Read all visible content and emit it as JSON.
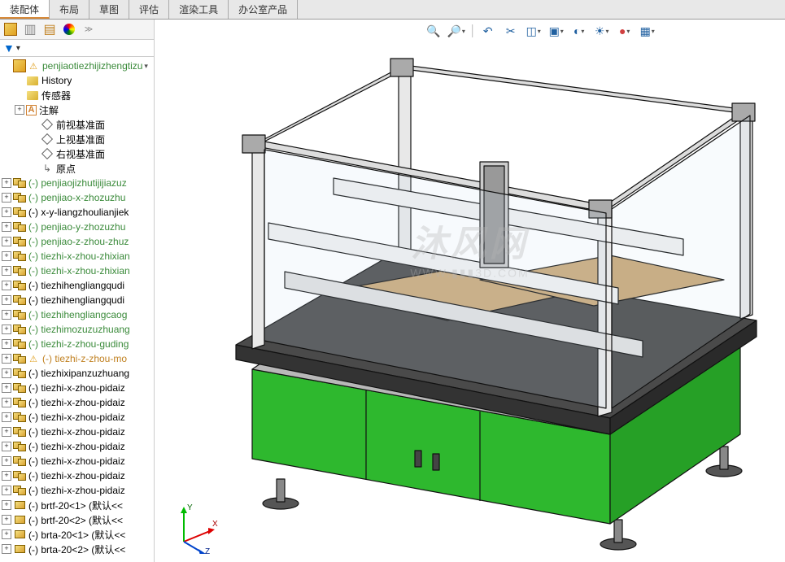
{
  "tabs": {
    "items": [
      "装配体",
      "布局",
      "草图",
      "评估",
      "渲染工具",
      "办公室产品"
    ],
    "active": 0
  },
  "sidebar": {
    "filter_label": "▼",
    "root": {
      "name": "penjiaotiezhijizhengtizu",
      "warn": true
    },
    "fixed": [
      {
        "icon": "folder",
        "label": "History"
      },
      {
        "icon": "folder",
        "label": "传感器"
      },
      {
        "icon": "ann",
        "label": "注解",
        "expandable": true
      },
      {
        "icon": "plane",
        "label": "前视基准面",
        "indent": 2
      },
      {
        "icon": "plane",
        "label": "上视基准面",
        "indent": 2
      },
      {
        "icon": "plane",
        "label": "右视基准面",
        "indent": 2
      },
      {
        "icon": "origin",
        "label": "原点",
        "indent": 2
      }
    ],
    "components": [
      {
        "type": "asm",
        "label": "(-) penjiaojizhutijijiazuz",
        "cls": "green-text"
      },
      {
        "type": "asm",
        "label": "(-) penjiao-x-zhozuzhu",
        "cls": "green-text"
      },
      {
        "type": "asm",
        "label": "(-) x-y-liangzhoulianjiek"
      },
      {
        "type": "asm",
        "label": "(-) penjiao-y-zhozuzhu",
        "cls": "green-text"
      },
      {
        "type": "asm",
        "label": "(-) penjiao-z-zhou-zhuz",
        "cls": "green-text"
      },
      {
        "type": "asm",
        "label": "(-) tiezhi-x-zhou-zhixian",
        "cls": "green-text"
      },
      {
        "type": "asm",
        "label": "(-) tiezhi-x-zhou-zhixian",
        "cls": "green-text"
      },
      {
        "type": "asm",
        "label": "(-) tiezhihengliangqudi"
      },
      {
        "type": "asm",
        "label": "(-) tiezhihengliangqudi"
      },
      {
        "type": "asm",
        "label": "(-) tiezhihengliangcaog",
        "cls": "green-text"
      },
      {
        "type": "asm",
        "label": "(-) tiezhimozuzuzhuang",
        "cls": "green-text"
      },
      {
        "type": "asm",
        "label": "(-) tiezhi-z-zhou-guding",
        "cls": "green-text"
      },
      {
        "type": "asm",
        "label": "(-) tiezhi-z-zhou-mo",
        "cls": "orange-text",
        "warn": true
      },
      {
        "type": "asm",
        "label": "(-) tiezhixipanzuzhuang"
      },
      {
        "type": "asm",
        "label": "(-) tiezhi-x-zhou-pidaiz"
      },
      {
        "type": "asm",
        "label": "(-) tiezhi-x-zhou-pidaiz"
      },
      {
        "type": "asm",
        "label": "(-) tiezhi-x-zhou-pidaiz"
      },
      {
        "type": "asm",
        "label": "(-) tiezhi-x-zhou-pidaiz"
      },
      {
        "type": "asm",
        "label": "(-) tiezhi-x-zhou-pidaiz"
      },
      {
        "type": "asm",
        "label": "(-) tiezhi-x-zhou-pidaiz"
      },
      {
        "type": "asm",
        "label": "(-) tiezhi-x-zhou-pidaiz"
      },
      {
        "type": "asm",
        "label": "(-) tiezhi-x-zhou-pidaiz"
      },
      {
        "type": "part",
        "label": "(-) brtf-20<1> (默认<<"
      },
      {
        "type": "part",
        "label": "(-) brtf-20<2> (默认<<"
      },
      {
        "type": "part",
        "label": "(-) brta-20<1> (默认<<"
      },
      {
        "type": "part",
        "label": "(-) brta-20<2> (默认<<"
      }
    ]
  },
  "view_toolbar": {
    "buttons": [
      {
        "name": "zoom-fit-icon",
        "glyph": "🔍",
        "drop": false
      },
      {
        "name": "zoom-area-icon",
        "glyph": "🔎",
        "drop": true
      },
      {
        "name": "sep"
      },
      {
        "name": "prev-view-icon",
        "glyph": "↶",
        "drop": false
      },
      {
        "name": "section-icon",
        "glyph": "✂",
        "drop": false
      },
      {
        "name": "view-orient-icon",
        "glyph": "◫",
        "drop": true
      },
      {
        "name": "display-style-icon",
        "glyph": "▣",
        "drop": true
      },
      {
        "name": "hide-show-icon",
        "glyph": "◐",
        "drop": true
      },
      {
        "name": "scene-icon",
        "glyph": "☀",
        "drop": true
      },
      {
        "name": "appearance-icon",
        "glyph": "●",
        "drop": true,
        "color": "#d04040"
      },
      {
        "name": "render-icon",
        "glyph": "▦",
        "drop": true
      }
    ]
  },
  "triad": {
    "x": "X",
    "y": "Y",
    "z": "Z"
  },
  "watermark": {
    "main": "沐风网",
    "sub": "WWW.▮▮▮3D.COM"
  }
}
